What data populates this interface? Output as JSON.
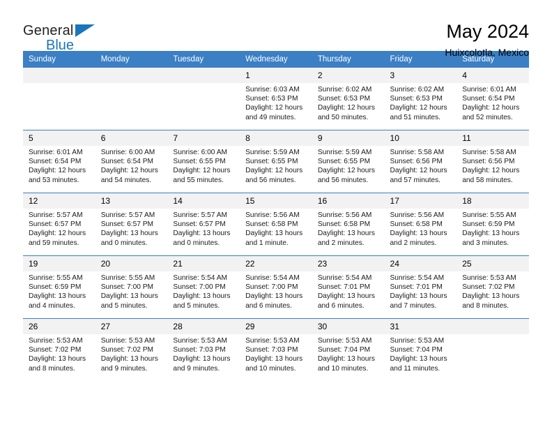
{
  "brand": {
    "name_top": "General",
    "name_bottom": "Blue",
    "accent_color": "#1b75bc",
    "triangle_icon": "brand-triangle-icon"
  },
  "header": {
    "title": "May 2024",
    "subtitle": "Huixcolotla, Mexico"
  },
  "calendar": {
    "header_bg": "#3b7fc4",
    "daynum_bg": "#f2f2f2",
    "weekdays": [
      "Sunday",
      "Monday",
      "Tuesday",
      "Wednesday",
      "Thursday",
      "Friday",
      "Saturday"
    ],
    "labels": {
      "sunrise": "Sunrise:",
      "sunset": "Sunset:",
      "daylight": "Daylight:"
    },
    "weeks": [
      [
        {
          "day": "",
          "empty": true
        },
        {
          "day": "",
          "empty": true
        },
        {
          "day": "",
          "empty": true
        },
        {
          "day": "1",
          "sunrise": "Sunrise: 6:03 AM",
          "sunset": "Sunset: 6:53 PM",
          "daylight": "Daylight: 12 hours and 49 minutes."
        },
        {
          "day": "2",
          "sunrise": "Sunrise: 6:02 AM",
          "sunset": "Sunset: 6:53 PM",
          "daylight": "Daylight: 12 hours and 50 minutes."
        },
        {
          "day": "3",
          "sunrise": "Sunrise: 6:02 AM",
          "sunset": "Sunset: 6:53 PM",
          "daylight": "Daylight: 12 hours and 51 minutes."
        },
        {
          "day": "4",
          "sunrise": "Sunrise: 6:01 AM",
          "sunset": "Sunset: 6:54 PM",
          "daylight": "Daylight: 12 hours and 52 minutes."
        }
      ],
      [
        {
          "day": "5",
          "sunrise": "Sunrise: 6:01 AM",
          "sunset": "Sunset: 6:54 PM",
          "daylight": "Daylight: 12 hours and 53 minutes."
        },
        {
          "day": "6",
          "sunrise": "Sunrise: 6:00 AM",
          "sunset": "Sunset: 6:54 PM",
          "daylight": "Daylight: 12 hours and 54 minutes."
        },
        {
          "day": "7",
          "sunrise": "Sunrise: 6:00 AM",
          "sunset": "Sunset: 6:55 PM",
          "daylight": "Daylight: 12 hours and 55 minutes."
        },
        {
          "day": "8",
          "sunrise": "Sunrise: 5:59 AM",
          "sunset": "Sunset: 6:55 PM",
          "daylight": "Daylight: 12 hours and 56 minutes."
        },
        {
          "day": "9",
          "sunrise": "Sunrise: 5:59 AM",
          "sunset": "Sunset: 6:55 PM",
          "daylight": "Daylight: 12 hours and 56 minutes."
        },
        {
          "day": "10",
          "sunrise": "Sunrise: 5:58 AM",
          "sunset": "Sunset: 6:56 PM",
          "daylight": "Daylight: 12 hours and 57 minutes."
        },
        {
          "day": "11",
          "sunrise": "Sunrise: 5:58 AM",
          "sunset": "Sunset: 6:56 PM",
          "daylight": "Daylight: 12 hours and 58 minutes."
        }
      ],
      [
        {
          "day": "12",
          "sunrise": "Sunrise: 5:57 AM",
          "sunset": "Sunset: 6:57 PM",
          "daylight": "Daylight: 12 hours and 59 minutes."
        },
        {
          "day": "13",
          "sunrise": "Sunrise: 5:57 AM",
          "sunset": "Sunset: 6:57 PM",
          "daylight": "Daylight: 13 hours and 0 minutes."
        },
        {
          "day": "14",
          "sunrise": "Sunrise: 5:57 AM",
          "sunset": "Sunset: 6:57 PM",
          "daylight": "Daylight: 13 hours and 0 minutes."
        },
        {
          "day": "15",
          "sunrise": "Sunrise: 5:56 AM",
          "sunset": "Sunset: 6:58 PM",
          "daylight": "Daylight: 13 hours and 1 minute."
        },
        {
          "day": "16",
          "sunrise": "Sunrise: 5:56 AM",
          "sunset": "Sunset: 6:58 PM",
          "daylight": "Daylight: 13 hours and 2 minutes."
        },
        {
          "day": "17",
          "sunrise": "Sunrise: 5:56 AM",
          "sunset": "Sunset: 6:58 PM",
          "daylight": "Daylight: 13 hours and 2 minutes."
        },
        {
          "day": "18",
          "sunrise": "Sunrise: 5:55 AM",
          "sunset": "Sunset: 6:59 PM",
          "daylight": "Daylight: 13 hours and 3 minutes."
        }
      ],
      [
        {
          "day": "19",
          "sunrise": "Sunrise: 5:55 AM",
          "sunset": "Sunset: 6:59 PM",
          "daylight": "Daylight: 13 hours and 4 minutes."
        },
        {
          "day": "20",
          "sunrise": "Sunrise: 5:55 AM",
          "sunset": "Sunset: 7:00 PM",
          "daylight": "Daylight: 13 hours and 5 minutes."
        },
        {
          "day": "21",
          "sunrise": "Sunrise: 5:54 AM",
          "sunset": "Sunset: 7:00 PM",
          "daylight": "Daylight: 13 hours and 5 minutes."
        },
        {
          "day": "22",
          "sunrise": "Sunrise: 5:54 AM",
          "sunset": "Sunset: 7:00 PM",
          "daylight": "Daylight: 13 hours and 6 minutes."
        },
        {
          "day": "23",
          "sunrise": "Sunrise: 5:54 AM",
          "sunset": "Sunset: 7:01 PM",
          "daylight": "Daylight: 13 hours and 6 minutes."
        },
        {
          "day": "24",
          "sunrise": "Sunrise: 5:54 AM",
          "sunset": "Sunset: 7:01 PM",
          "daylight": "Daylight: 13 hours and 7 minutes."
        },
        {
          "day": "25",
          "sunrise": "Sunrise: 5:53 AM",
          "sunset": "Sunset: 7:02 PM",
          "daylight": "Daylight: 13 hours and 8 minutes."
        }
      ],
      [
        {
          "day": "26",
          "sunrise": "Sunrise: 5:53 AM",
          "sunset": "Sunset: 7:02 PM",
          "daylight": "Daylight: 13 hours and 8 minutes."
        },
        {
          "day": "27",
          "sunrise": "Sunrise: 5:53 AM",
          "sunset": "Sunset: 7:02 PM",
          "daylight": "Daylight: 13 hours and 9 minutes."
        },
        {
          "day": "28",
          "sunrise": "Sunrise: 5:53 AM",
          "sunset": "Sunset: 7:03 PM",
          "daylight": "Daylight: 13 hours and 9 minutes."
        },
        {
          "day": "29",
          "sunrise": "Sunrise: 5:53 AM",
          "sunset": "Sunset: 7:03 PM",
          "daylight": "Daylight: 13 hours and 10 minutes."
        },
        {
          "day": "30",
          "sunrise": "Sunrise: 5:53 AM",
          "sunset": "Sunset: 7:04 PM",
          "daylight": "Daylight: 13 hours and 10 minutes."
        },
        {
          "day": "31",
          "sunrise": "Sunrise: 5:53 AM",
          "sunset": "Sunset: 7:04 PM",
          "daylight": "Daylight: 13 hours and 11 minutes."
        },
        {
          "day": "",
          "empty": true
        }
      ]
    ]
  }
}
